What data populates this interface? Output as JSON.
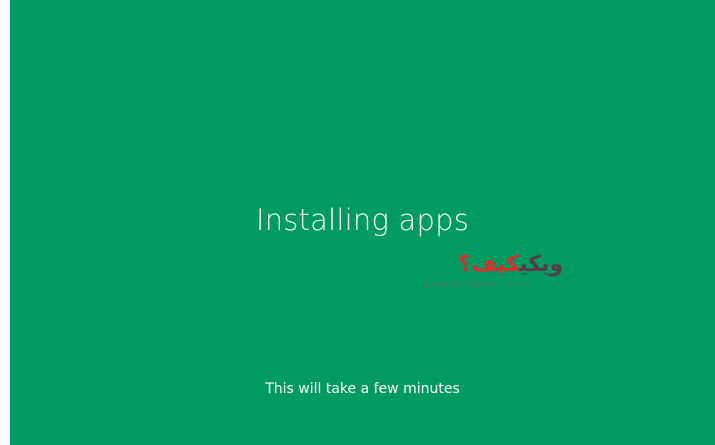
{
  "colors": {
    "background": "#009b62",
    "text": "#ffffff"
  },
  "setup": {
    "title": "Installing apps",
    "subtitle": "This will take a few minutes"
  },
  "watermark": {
    "logo_dark": "ويكي",
    "logo_red": "كيف؟",
    "url": "www.wikikeef.com"
  }
}
